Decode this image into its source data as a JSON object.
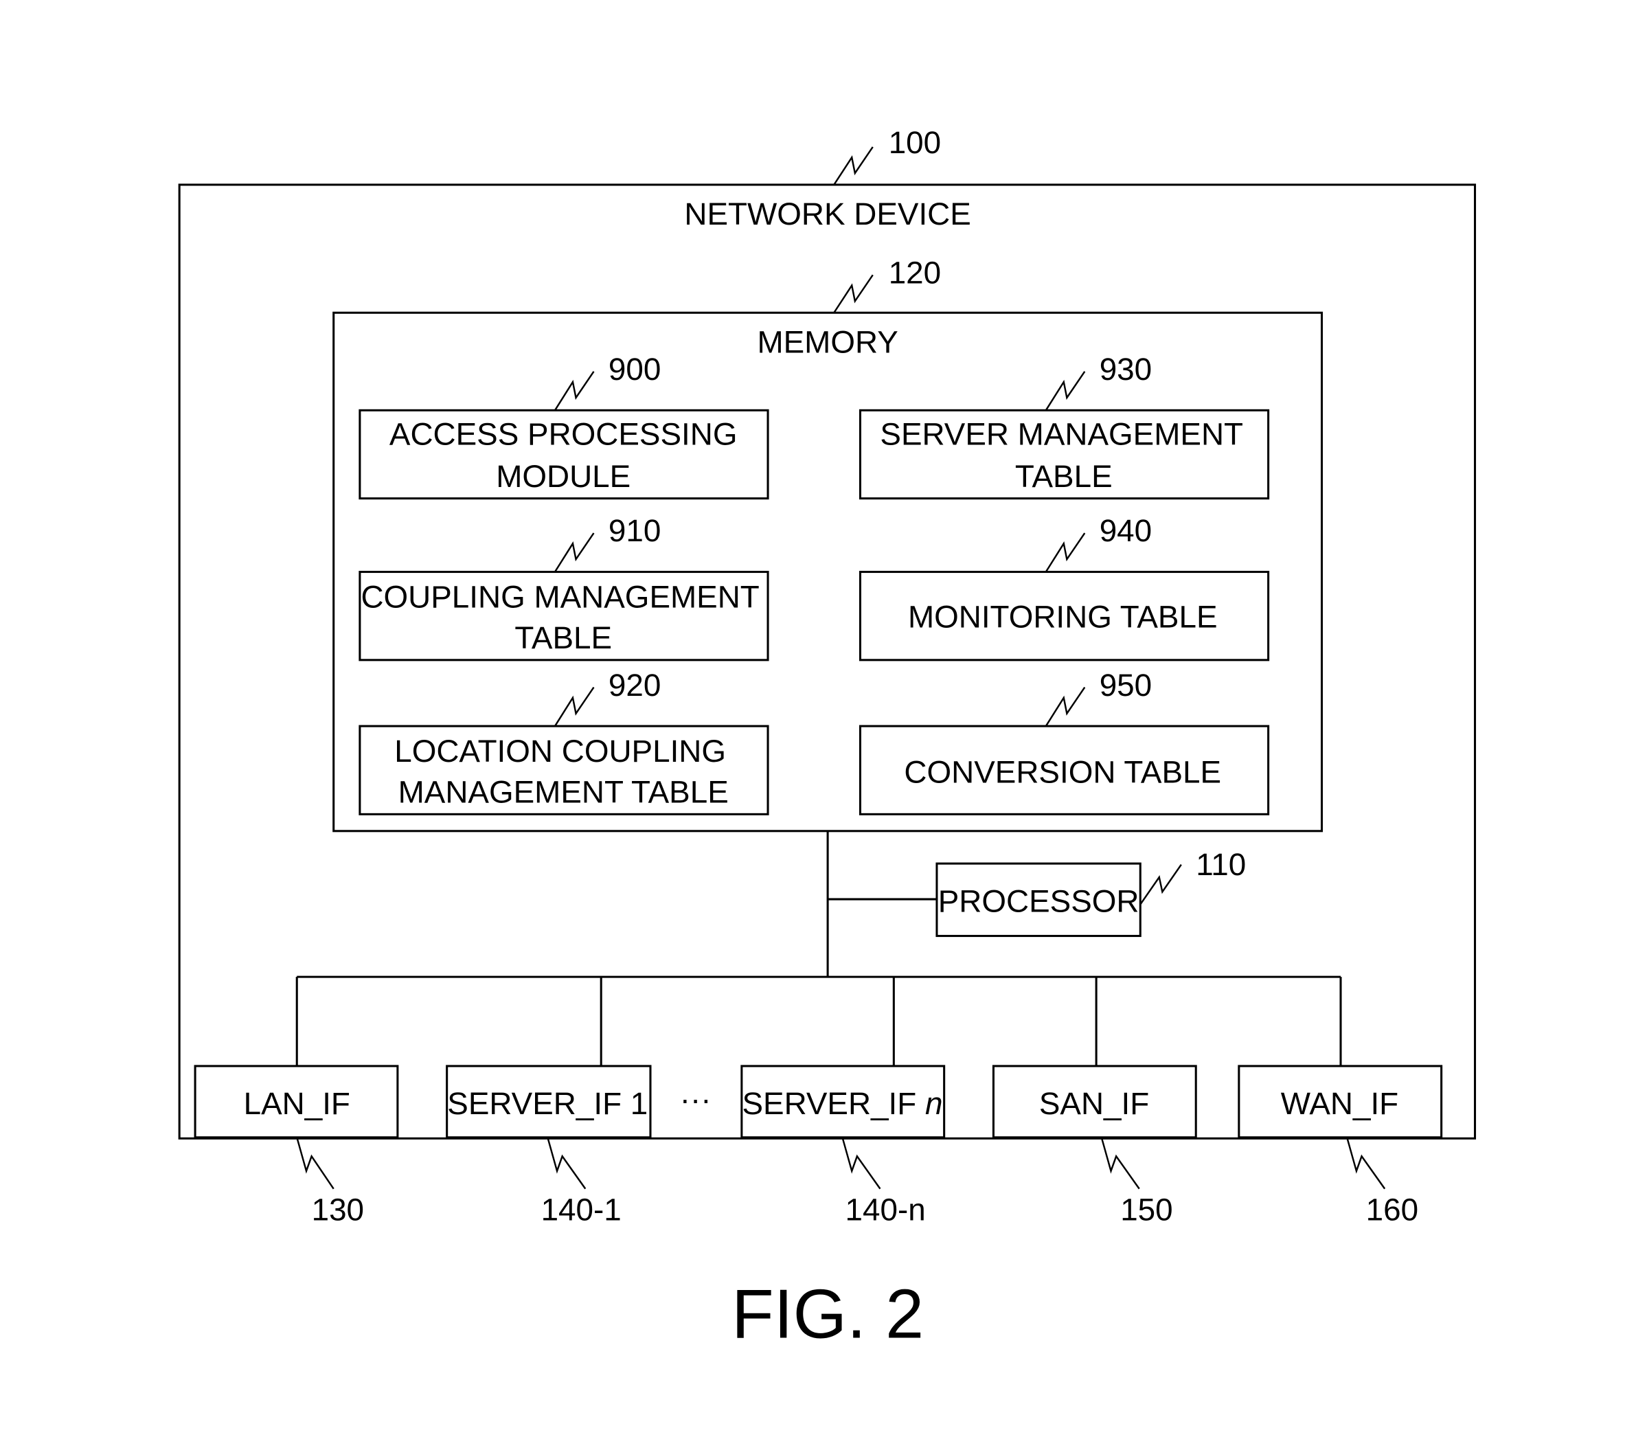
{
  "figure_label": "FIG. 2",
  "network_device": {
    "label": "NETWORK DEVICE",
    "ref": "100"
  },
  "memory": {
    "label": "MEMORY",
    "ref": "120",
    "modules": [
      {
        "line1": "ACCESS PROCESSING",
        "line2": "MODULE",
        "ref": "900"
      },
      {
        "line1": "SERVER MANAGEMENT",
        "line2": "TABLE",
        "ref": "930"
      },
      {
        "line1": "COUPLING MANAGEMENT",
        "line2": "TABLE",
        "ref": "910"
      },
      {
        "line1": "MONITORING TABLE",
        "line2": "",
        "ref": "940"
      },
      {
        "line1": "LOCATION COUPLING",
        "line2": "MANAGEMENT TABLE",
        "ref": "920"
      },
      {
        "line1": "CONVERSION TABLE",
        "line2": "",
        "ref": "950"
      }
    ]
  },
  "processor": {
    "label": "PROCESSOR",
    "ref": "110"
  },
  "interfaces": [
    {
      "label": "LAN_IF",
      "suffix": "",
      "ref": "130"
    },
    {
      "label": "SERVER_IF 1",
      "suffix": "",
      "ref": "140-1"
    },
    {
      "label": "SERVER_IF ",
      "suffix": "n",
      "ref": "140-n"
    },
    {
      "label": "SAN_IF",
      "suffix": "",
      "ref": "150"
    },
    {
      "label": "WAN_IF",
      "suffix": "",
      "ref": "160"
    }
  ],
  "ellipsis": "···"
}
